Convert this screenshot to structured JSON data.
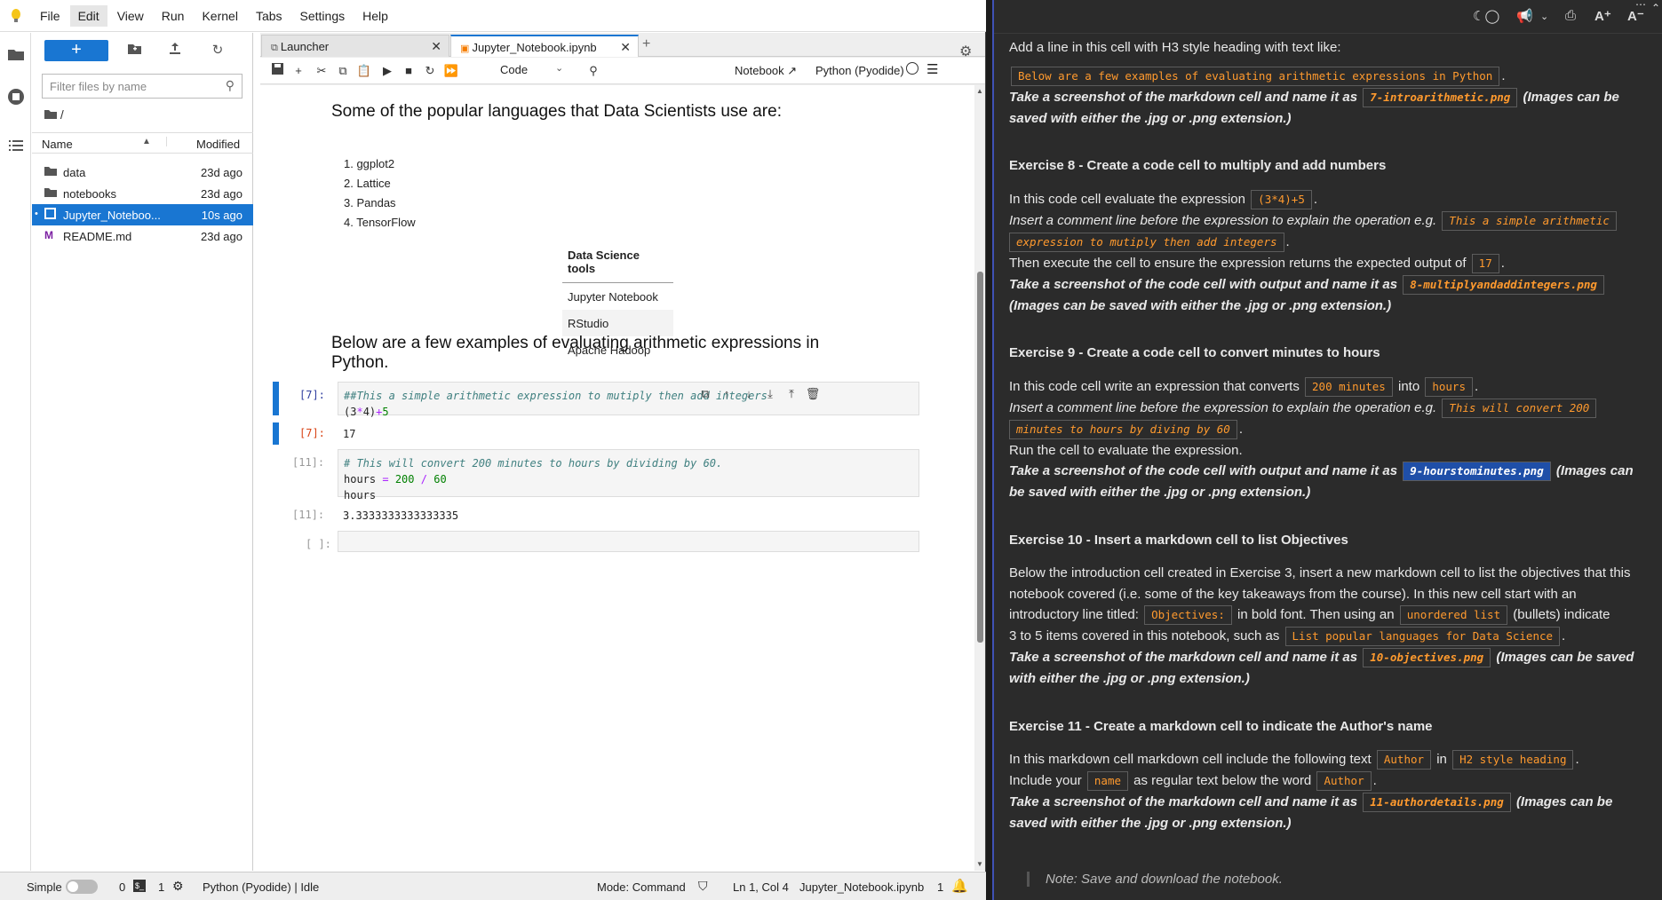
{
  "menubar": {
    "items": [
      "File",
      "Edit",
      "View",
      "Run",
      "Kernel",
      "Tabs",
      "Settings",
      "Help"
    ]
  },
  "filebrowser": {
    "filter_placeholder": "Filter files by name",
    "path": "/",
    "col_name": "Name",
    "col_modified": "Modified",
    "files": [
      {
        "name": "data",
        "modified": "23d ago",
        "type": "folder"
      },
      {
        "name": "notebooks",
        "modified": "23d ago",
        "type": "folder"
      },
      {
        "name": "Jupyter_Noteboo...",
        "modified": "10s ago",
        "type": "notebook"
      },
      {
        "name": "README.md",
        "modified": "23d ago",
        "type": "markdown"
      }
    ]
  },
  "tabs": [
    {
      "label": "Launcher"
    },
    {
      "label": "Jupyter_Notebook.ipynb"
    }
  ],
  "toolbar": {
    "cell_type": "Code",
    "notebook_link": "Notebook",
    "kernel": "Python (Pyodide)"
  },
  "notebook": {
    "heading1": "Some of the popular languages that Data Scientists use are:",
    "list": [
      "1. ggplot2",
      "2. Lattice",
      "3. Pandas",
      "4. TensorFlow"
    ],
    "table_header": "Data Science tools",
    "table_rows": [
      "Jupyter Notebook",
      "RStudio",
      "Apache Hadoop"
    ],
    "heading2_line1": "Below are a few examples of evaluating arithmetic expressions in",
    "heading2_line2": "Python.",
    "cell1": {
      "prompt": "[7]:",
      "comment": "##This a simple arithmetic expression to mutiply then add integers",
      "code_a": "(3",
      "code_op1": "*",
      "code_b": "4)",
      "code_op2": "+",
      "code_c": "5",
      "out_prompt": "[7]:",
      "output": "17"
    },
    "cell2": {
      "prompt": "[11]:",
      "comment": "# This will convert 200 minutes to hours by dividing by 60.",
      "line2_a": "hours ",
      "line2_eq": "=",
      "line2_n1": "200",
      "line2_div": "/",
      "line2_n2": "60",
      "line3": "hours",
      "out_prompt": "[11]:",
      "output": "3.3333333333333335"
    },
    "cell3": {
      "prompt": "[ ]:"
    }
  },
  "statusbar": {
    "mode_label": "Simple",
    "terminals": "0",
    "kernels": "1",
    "kernel_status": "Python (Pyodide) | Idle",
    "mode": "Mode: Command",
    "cursor": "Ln 1, Col 4",
    "file": "Jupyter_Notebook.ipynb",
    "notifications": "1"
  },
  "instructions": {
    "intro": "Add a line in this cell with H3 style heading with text like:",
    "intro_chip": "Below are a few examples of evaluating arithmetic expressions in Python",
    "intro_shot_a": "Take a screenshot of the markdown cell and name it as",
    "intro_shot_chip": "7-introarithmetic.png",
    "intro_shot_b": "(Images can be",
    "intro_shot_c": "saved with either the .jpg or .png extension.)",
    "ex8_title": "Exercise 8 - Create a code cell to multiply and add numbers",
    "ex8_l1": "In this code cell evaluate the expression",
    "ex8_l1_chip": "(3*4)+5",
    "ex8_l2": "Insert a comment line before the expression to explain the operation e.g.",
    "ex8_l2_chip_a": "This a simple arithmetic",
    "ex8_l2_chip_b": "expression to mutiply then add integers",
    "ex8_l3": "Then execute the cell to ensure the expression returns the expected output of",
    "ex8_l3_chip": "17",
    "ex8_shot_a": "Take a screenshot of the code cell with output and name it as",
    "ex8_shot_chip": "8-multiplyandaddintegers.png",
    "ex8_shot_b": "(Images can be saved with either the .jpg or .png extension.)",
    "ex9_title": "Exercise 9 - Create a code cell to convert minutes to hours",
    "ex9_l1": "In this code cell write an expression that converts",
    "ex9_l1_chip1": "200 minutes",
    "ex9_l1_into": "into",
    "ex9_l1_chip2": "hours",
    "ex9_l2": "Insert a comment line before the expression to explain the operation e.g.",
    "ex9_l2_chip_a": "This will convert 200",
    "ex9_l2_chip_b": "minutes to hours by diving by 60",
    "ex9_l3": "Run the cell to evaluate the expression.",
    "ex9_shot_a": "Take a screenshot of the code cell with output and name it as",
    "ex9_shot_chip": "9-hourstominutes.png",
    "ex9_shot_b": "(Images can",
    "ex9_shot_c": "be saved with either the .jpg or .png extension.)",
    "ex10_title": "Exercise 10 - Insert a markdown cell to list Objectives",
    "ex10_l1": "Below the introduction cell created in Exercise 3, insert a new markdown cell to list the objectives that this",
    "ex10_l2": "notebook covered (i.e. some of the key takeaways from the course). In this new cell start with an",
    "ex10_l3a": "introductory line titled:",
    "ex10_l3_chip1": "Objectives:",
    "ex10_l3b": "in bold font. Then using an",
    "ex10_l3_chip2": "unordered list",
    "ex10_l3c": "(bullets) indicate",
    "ex10_l4a": "3 to 5 items covered in this notebook, such as",
    "ex10_l4_chip": "List popular languages for Data Science",
    "ex10_shot_a": "Take a screenshot of the markdown cell and name it as",
    "ex10_shot_chip": "10-objectives.png",
    "ex10_shot_b": "(Images can be saved",
    "ex10_shot_c": "with either the .jpg or .png extension.)",
    "ex11_title": "Exercise 11 - Create a markdown cell to indicate the Author's name",
    "ex11_l1": "In this markdown cell markdown cell include the following text",
    "ex11_l1_chip1": "Author",
    "ex11_l1_in": "in",
    "ex11_l1_chip2": "H2 style heading",
    "ex11_l2a": "Include your",
    "ex11_l2_chip1": "name",
    "ex11_l2b": "as regular text below the word",
    "ex11_l2_chip2": "Author",
    "ex11_shot_a": "Take a screenshot of the markdown cell and name it as",
    "ex11_shot_chip": "11-authordetails.png",
    "ex11_shot_b": "(Images can be",
    "ex11_shot_c": "saved with either the .jpg or .png extension.)",
    "note": "Note: Save and download the notebook."
  },
  "colors": {
    "accent": "#1976d2",
    "code_chip_text": "#ff9a2e",
    "panel_bg": "#2b2b2b"
  }
}
